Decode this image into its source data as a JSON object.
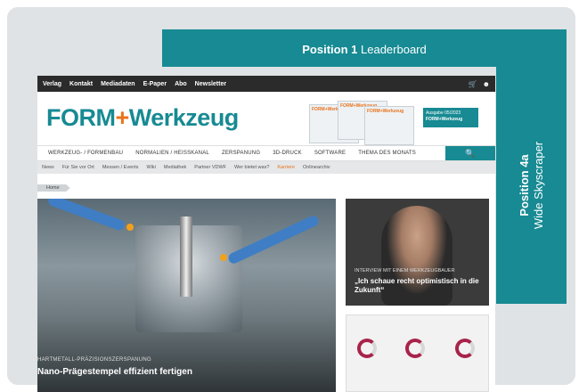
{
  "ad_slots": {
    "leaderboard": {
      "bold": "Position 1",
      "label": "Leaderboard"
    },
    "skyscraper": {
      "bold": "Position 4a",
      "label": "Wide Skyscraper"
    }
  },
  "site": {
    "topbar": [
      "Verlag",
      "Kontakt",
      "Mediadaten",
      "E-Paper",
      "Abo",
      "Newsletter"
    ],
    "icons": {
      "cart": "cart-icon",
      "user": "user-icon"
    },
    "logo": {
      "part1": "FORM",
      "plus": "+",
      "part2": "Werkzeug"
    },
    "magazine": {
      "cover_text": "FORM+Werkzeug",
      "issue_line": "Ausgabe 05/2023",
      "issue_brand": "FORM+Werkzeug"
    },
    "main_nav": [
      "WERKZEUG- / FORMENBAU",
      "NORMALIEN / HEISSKANAL",
      "ZERSPANUNG",
      "3D-DRUCK",
      "SOFTWARE",
      "THEMA DES MONATS"
    ],
    "search_icon": "search-icon",
    "sub_nav": [
      "News",
      "Für Sie vor Ort",
      "Messen / Events",
      "Wiki",
      "Mediathek",
      "Partner VDWF",
      "Wer bietet was?",
      "Karriere",
      "Onlinearchiv"
    ],
    "breadcrumb": "Home",
    "hero": {
      "category": "HARTMETALL-PRÄZISIONSZERSPANUNG",
      "title": "Nano-Prägestempel effizient fertigen"
    },
    "interview": {
      "category": "INTERVIEW MIT EINEM WERKZEUGBAUER",
      "title": "„Ich schaue recht optimistisch in die Zukunft“"
    }
  },
  "colors": {
    "brand_teal": "#178a93",
    "brand_orange": "#e8731c",
    "background": "#dfe3e5"
  }
}
